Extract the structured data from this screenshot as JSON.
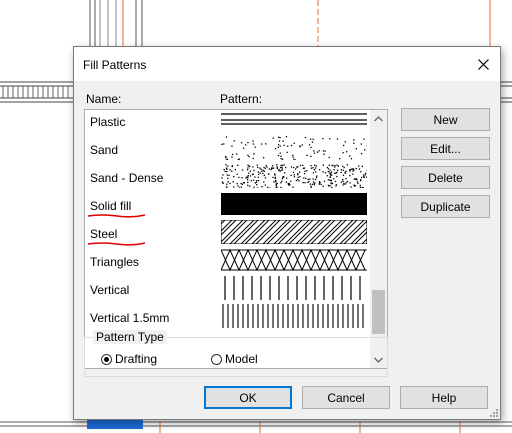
{
  "dialog": {
    "title": "Fill Patterns",
    "name_header": "Name:",
    "pattern_header": "Pattern:"
  },
  "patterns": [
    {
      "name": "Plastic",
      "pattern": "plastic"
    },
    {
      "name": "Sand",
      "pattern": "sand"
    },
    {
      "name": "Sand - Dense",
      "pattern": "sand-dense"
    },
    {
      "name": "Solid fill",
      "pattern": "solid",
      "underline": "#e00000"
    },
    {
      "name": "Steel",
      "pattern": "steel",
      "underline": "#e00000"
    },
    {
      "name": "Triangles",
      "pattern": "triangles"
    },
    {
      "name": "Vertical",
      "pattern": "vertical"
    },
    {
      "name": "Vertical 1.5mm",
      "pattern": "vertical-dense"
    }
  ],
  "side_buttons": {
    "new": "New",
    "edit": "Edit...",
    "delete": "Delete",
    "duplicate": "Duplicate"
  },
  "pattern_type": {
    "label": "Pattern Type",
    "options": [
      {
        "label": "Drafting",
        "selected": true
      },
      {
        "label": "Model",
        "selected": false
      }
    ]
  },
  "footer_buttons": {
    "ok": "OK",
    "cancel": "Cancel",
    "help": "Help"
  },
  "icons": {
    "close": "close-icon",
    "scroll_up": "chevron-up-icon",
    "scroll_down": "chevron-down-icon",
    "resize": "resize-grip-icon"
  },
  "colors": {
    "annotation_underline": "#e00000",
    "default_button_border": "#0078d7",
    "background_drawing_red": "#e07030",
    "background_selection_blue": "#1e6bd6"
  }
}
